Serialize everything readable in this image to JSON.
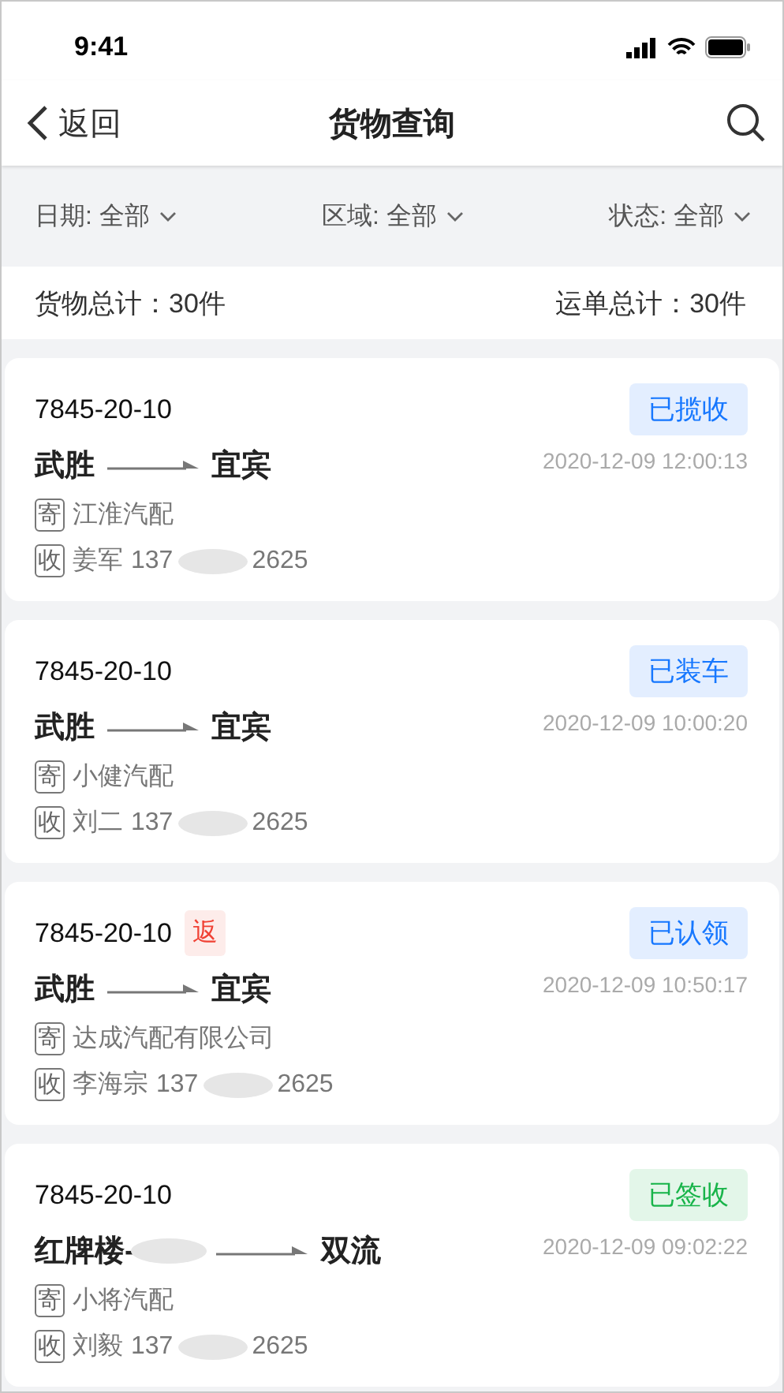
{
  "status_bar": {
    "time": "9:41"
  },
  "nav": {
    "back": "返回",
    "title": "货物查询"
  },
  "filters": [
    {
      "label": "日期: 全部"
    },
    {
      "label": "区域: 全部"
    },
    {
      "label": "状态: 全部"
    }
  ],
  "summary": {
    "goods": "货物总计：30件",
    "waybills": "运单总计：30件"
  },
  "orders": [
    {
      "number": "7845-20-10",
      "returned": false,
      "status": "已揽收",
      "color": "#1677ff",
      "from": "武胜",
      "from_blurred": false,
      "to": "宜宾",
      "time": "2020-12-09 12:00:13",
      "sender_mark": "寄",
      "sender": "江淮汽配",
      "receiver_mark": "收",
      "receiver": "姜军",
      "phone_head": "137",
      "phone_tail": "2625"
    },
    {
      "number": "7845-20-10",
      "returned": false,
      "status": "已装车",
      "color": "#1677ff",
      "from": "武胜",
      "from_blurred": false,
      "to": "宜宾",
      "time": "2020-12-09 10:00:20",
      "sender_mark": "寄",
      "sender": "小健汽配",
      "receiver_mark": "收",
      "receiver": "刘二",
      "phone_head": "137",
      "phone_tail": "2625"
    },
    {
      "number": "7845-20-10",
      "returned": true,
      "return_label": "返",
      "status": "已认领",
      "color": "#1677ff",
      "from": "武胜",
      "from_blurred": false,
      "to": "宜宾",
      "time": "2020-12-09 10:50:17",
      "sender_mark": "寄",
      "sender": "达成汽配有限公司",
      "receiver_mark": "收",
      "receiver": "李海宗",
      "phone_head": "137",
      "phone_tail": "2625"
    },
    {
      "number": "7845-20-10",
      "returned": false,
      "status": "已签收",
      "color": "#18b44a",
      "from": "红牌楼-",
      "from_blurred": true,
      "to": "双流",
      "time": "2020-12-09 09:02:22",
      "sender_mark": "寄",
      "sender": "小将汽配",
      "receiver_mark": "收",
      "receiver": "刘毅",
      "phone_head": "137",
      "phone_tail": "2625"
    }
  ]
}
